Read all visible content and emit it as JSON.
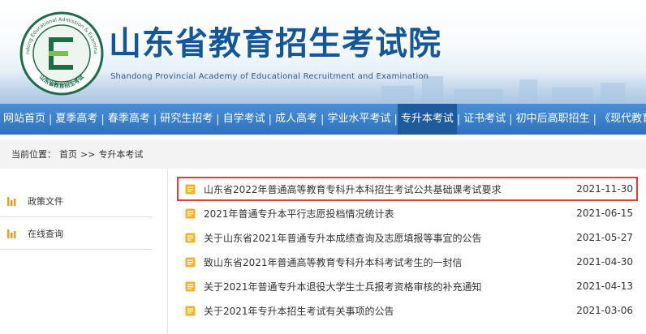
{
  "header": {
    "title": "山东省教育招生考试院",
    "subtitle": "Shandong Provincial Academy of Educational Recruitment and Examination",
    "logo_ring_text_top": "Shandong Educational Admission & Examination",
    "logo_ring_text_bottom": "山东省教育招生考试",
    "logo_letter": "E"
  },
  "nav": {
    "items": [
      {
        "label": "网站首页"
      },
      {
        "label": "夏季高考"
      },
      {
        "label": "春季高考"
      },
      {
        "label": "研究生招考"
      },
      {
        "label": "自学考试"
      },
      {
        "label": "成人高考"
      },
      {
        "label": "学业水平考试"
      },
      {
        "label": "专升本考试"
      },
      {
        "label": "证书考试"
      },
      {
        "label": "初中后高职招生"
      },
      {
        "label": "《现代教育》"
      }
    ],
    "active_index": 7,
    "separator": "|"
  },
  "breadcrumb": {
    "prefix": "当前位置：",
    "home": "首页",
    "separator": ">>",
    "current": "专升本考试"
  },
  "sidebar": {
    "items": [
      {
        "label": "政策文件",
        "icon": "bar-chart-icon"
      },
      {
        "label": "在线查询",
        "icon": "bar-chart-icon"
      }
    ]
  },
  "articles": [
    {
      "title": "山东省2022年普通高等教育专科升本科招生考试公共基础课考试要求",
      "date": "2021-11-30",
      "highlighted": true
    },
    {
      "title": "2021年普通专升本平行志愿投档情况统计表",
      "date": "2021-06-15",
      "highlighted": false
    },
    {
      "title": "关于山东省2021年普通专升本成绩查询及志愿填报等事宜的公告",
      "date": "2021-05-27",
      "highlighted": false
    },
    {
      "title": "致山东省2021年普通高等教育专科升本科考试考生的一封信",
      "date": "2021-04-30",
      "highlighted": false
    },
    {
      "title": "关于2021年普通专升本退役大学生士兵报考资格审核的补充通知",
      "date": "2021-04-13",
      "highlighted": false
    },
    {
      "title": "关于2021年专升本招生考试有关事项的公告",
      "date": "2021-03-06",
      "highlighted": false
    }
  ],
  "colors": {
    "brand_blue": "#14569c",
    "nav_bg": "#2e72c0",
    "nav_active": "#1e5a9e",
    "icon_orange": "#f0a020",
    "highlight_border": "#e03c3c"
  }
}
